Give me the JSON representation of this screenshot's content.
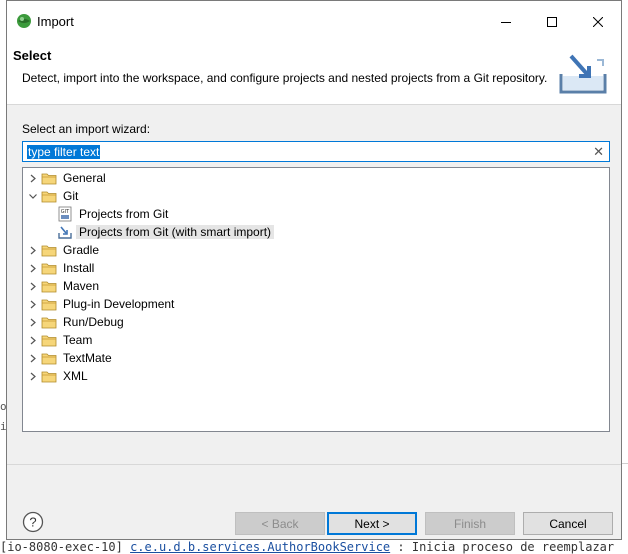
{
  "window": {
    "title": "Import",
    "controls": {
      "minimize": "minimize-icon",
      "maximize": "maximize-icon",
      "close": "close-icon"
    }
  },
  "header": {
    "title": "Select",
    "description": "Detect, import into the workspace, and configure projects and nested projects from a Git repository."
  },
  "wizard": {
    "label": "Select an import wizard:",
    "filter_value": "type filter text",
    "clear_icon": "clear-icon"
  },
  "tree": [
    {
      "label": "General",
      "level": 0,
      "expanded": false,
      "icon": "folder-icon"
    },
    {
      "label": "Git",
      "level": 0,
      "expanded": true,
      "icon": "folder-icon"
    },
    {
      "label": "Projects from Git",
      "level": 1,
      "icon": "git-repo-icon"
    },
    {
      "label": "Projects from Git (with smart import)",
      "level": 1,
      "icon": "smart-import-icon",
      "selected": true
    },
    {
      "label": "Gradle",
      "level": 0,
      "expanded": false,
      "icon": "folder-icon"
    },
    {
      "label": "Install",
      "level": 0,
      "expanded": false,
      "icon": "folder-icon"
    },
    {
      "label": "Maven",
      "level": 0,
      "expanded": false,
      "icon": "folder-icon"
    },
    {
      "label": "Plug-in Development",
      "level": 0,
      "expanded": false,
      "icon": "folder-icon"
    },
    {
      "label": "Run/Debug",
      "level": 0,
      "expanded": false,
      "icon": "folder-icon"
    },
    {
      "label": "Team",
      "level": 0,
      "expanded": false,
      "icon": "folder-icon"
    },
    {
      "label": "TextMate",
      "level": 0,
      "expanded": false,
      "icon": "folder-icon"
    },
    {
      "label": "XML",
      "level": 0,
      "expanded": false,
      "icon": "folder-icon"
    }
  ],
  "buttons": {
    "back": "< Back",
    "next": "Next >",
    "finish": "Finish",
    "cancel": "Cancel"
  },
  "background": {
    "bottom_text_1": "[io-8080-exec-10]",
    "bottom_link": "c.e.u.d.b.services.AuthorBookService",
    "bottom_text_2": ": Inicia proceso de reemplazar",
    "left_fragments": [
      "or",
      "ip"
    ]
  },
  "colors": {
    "accent": "#0078d7",
    "dialog_bg": "#f0f0f0",
    "folder": "#e8b64a",
    "selection": "#e5e5e5"
  }
}
